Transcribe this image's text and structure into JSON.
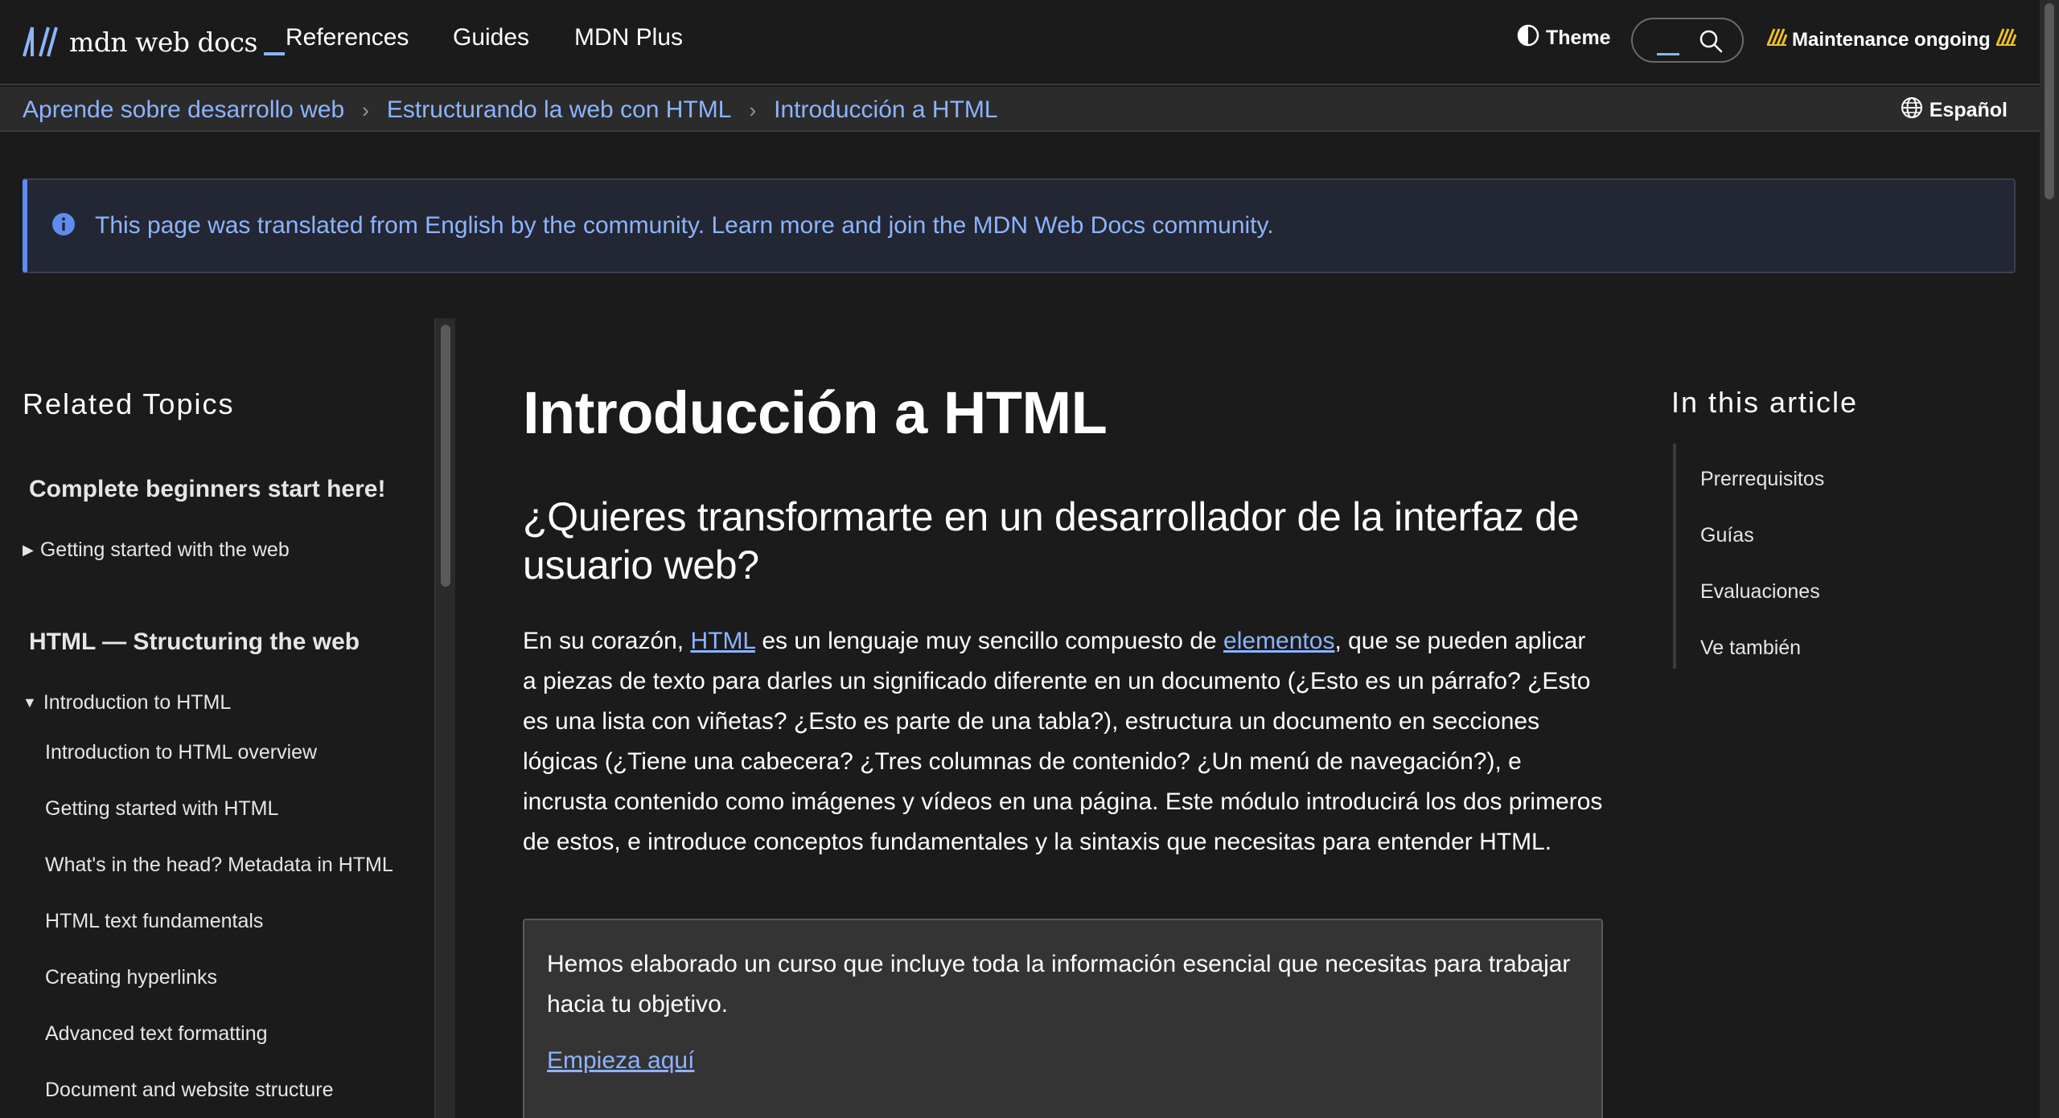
{
  "header": {
    "logo_text": "mdn web docs",
    "nav": [
      "References",
      "Guides",
      "MDN Plus"
    ],
    "theme_label": "Theme",
    "search_placeholder": "",
    "maintenance_label": "Maintenance ongoing"
  },
  "breadcrumb": {
    "items": [
      "Aprende sobre desarrollo web",
      "Estructurando la web con HTML",
      "Introducción a HTML"
    ],
    "language": "Español"
  },
  "notice": {
    "text": "This page was translated from English by the community. Learn more and join the MDN Web Docs community."
  },
  "sidebar": {
    "title": "Related Topics",
    "section1": "Complete beginners start here!",
    "group1": "Getting started with the web",
    "section2": "HTML — Structuring the web",
    "group2": "Introduction to HTML",
    "items": [
      "Introduction to HTML overview",
      "Getting started with HTML",
      "What's in the head? Metadata in HTML",
      "HTML text fundamentals",
      "Creating hyperlinks",
      "Advanced text formatting",
      "Document and website structure"
    ]
  },
  "main": {
    "title": "Introducción a HTML",
    "subtitle": "¿Quieres transformarte en un desarrollador de la interfaz de usuario web?",
    "para_1": "En su corazón, ",
    "link_html": "HTML",
    "para_2": " es un lenguaje muy sencillo compuesto de ",
    "link_elementos": "elementos",
    "para_3": ", que se pueden aplicar a piezas de texto para darles un significado diferente en un documento (¿Esto es un párrafo? ¿Esto es una lista con viñetas? ¿Esto es parte de una tabla?), estructura un documento en secciones lógicas (¿Tiene una cabecera? ¿Tres columnas de contenido? ¿Un menú de navegación?), e incrusta contenido como imágenes y vídeos en una página. Este módulo introducirá los dos primeros de estos, e introduce conceptos fundamentales y la sintaxis que necesitas para entender HTML.",
    "course_text": "Hemos elaborado un curso que incluye toda la información esencial que necesitas para trabajar hacia tu objetivo.",
    "course_link": "Empieza aquí"
  },
  "toc": {
    "title": "In this article",
    "items": [
      "Prerrequisitos",
      "Guías",
      "Evaluaciones",
      "Ve también"
    ]
  },
  "colors": {
    "background": "#1b1b1b",
    "link": "#8cb4ff",
    "notice_accent": "#5e8cf0",
    "maintenance_stripe": "#f0c020"
  }
}
